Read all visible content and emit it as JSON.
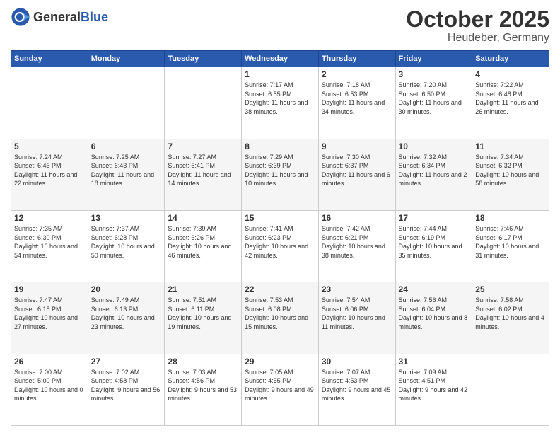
{
  "header": {
    "logo_general": "General",
    "logo_blue": "Blue",
    "month": "October 2025",
    "location": "Heudeber, Germany"
  },
  "weekdays": [
    "Sunday",
    "Monday",
    "Tuesday",
    "Wednesday",
    "Thursday",
    "Friday",
    "Saturday"
  ],
  "weeks": [
    [
      {
        "day": "",
        "info": ""
      },
      {
        "day": "",
        "info": ""
      },
      {
        "day": "",
        "info": ""
      },
      {
        "day": "1",
        "info": "Sunrise: 7:17 AM\nSunset: 6:55 PM\nDaylight: 11 hours\nand 38 minutes."
      },
      {
        "day": "2",
        "info": "Sunrise: 7:18 AM\nSunset: 6:53 PM\nDaylight: 11 hours\nand 34 minutes."
      },
      {
        "day": "3",
        "info": "Sunrise: 7:20 AM\nSunset: 6:50 PM\nDaylight: 11 hours\nand 30 minutes."
      },
      {
        "day": "4",
        "info": "Sunrise: 7:22 AM\nSunset: 6:48 PM\nDaylight: 11 hours\nand 26 minutes."
      }
    ],
    [
      {
        "day": "5",
        "info": "Sunrise: 7:24 AM\nSunset: 6:46 PM\nDaylight: 11 hours\nand 22 minutes."
      },
      {
        "day": "6",
        "info": "Sunrise: 7:25 AM\nSunset: 6:43 PM\nDaylight: 11 hours\nand 18 minutes."
      },
      {
        "day": "7",
        "info": "Sunrise: 7:27 AM\nSunset: 6:41 PM\nDaylight: 11 hours\nand 14 minutes."
      },
      {
        "day": "8",
        "info": "Sunrise: 7:29 AM\nSunset: 6:39 PM\nDaylight: 11 hours\nand 10 minutes."
      },
      {
        "day": "9",
        "info": "Sunrise: 7:30 AM\nSunset: 6:37 PM\nDaylight: 11 hours\nand 6 minutes."
      },
      {
        "day": "10",
        "info": "Sunrise: 7:32 AM\nSunset: 6:34 PM\nDaylight: 11 hours\nand 2 minutes."
      },
      {
        "day": "11",
        "info": "Sunrise: 7:34 AM\nSunset: 6:32 PM\nDaylight: 10 hours\nand 58 minutes."
      }
    ],
    [
      {
        "day": "12",
        "info": "Sunrise: 7:35 AM\nSunset: 6:30 PM\nDaylight: 10 hours\nand 54 minutes."
      },
      {
        "day": "13",
        "info": "Sunrise: 7:37 AM\nSunset: 6:28 PM\nDaylight: 10 hours\nand 50 minutes."
      },
      {
        "day": "14",
        "info": "Sunrise: 7:39 AM\nSunset: 6:26 PM\nDaylight: 10 hours\nand 46 minutes."
      },
      {
        "day": "15",
        "info": "Sunrise: 7:41 AM\nSunset: 6:23 PM\nDaylight: 10 hours\nand 42 minutes."
      },
      {
        "day": "16",
        "info": "Sunrise: 7:42 AM\nSunset: 6:21 PM\nDaylight: 10 hours\nand 38 minutes."
      },
      {
        "day": "17",
        "info": "Sunrise: 7:44 AM\nSunset: 6:19 PM\nDaylight: 10 hours\nand 35 minutes."
      },
      {
        "day": "18",
        "info": "Sunrise: 7:46 AM\nSunset: 6:17 PM\nDaylight: 10 hours\nand 31 minutes."
      }
    ],
    [
      {
        "day": "19",
        "info": "Sunrise: 7:47 AM\nSunset: 6:15 PM\nDaylight: 10 hours\nand 27 minutes."
      },
      {
        "day": "20",
        "info": "Sunrise: 7:49 AM\nSunset: 6:13 PM\nDaylight: 10 hours\nand 23 minutes."
      },
      {
        "day": "21",
        "info": "Sunrise: 7:51 AM\nSunset: 6:11 PM\nDaylight: 10 hours\nand 19 minutes."
      },
      {
        "day": "22",
        "info": "Sunrise: 7:53 AM\nSunset: 6:08 PM\nDaylight: 10 hours\nand 15 minutes."
      },
      {
        "day": "23",
        "info": "Sunrise: 7:54 AM\nSunset: 6:06 PM\nDaylight: 10 hours\nand 11 minutes."
      },
      {
        "day": "24",
        "info": "Sunrise: 7:56 AM\nSunset: 6:04 PM\nDaylight: 10 hours\nand 8 minutes."
      },
      {
        "day": "25",
        "info": "Sunrise: 7:58 AM\nSunset: 6:02 PM\nDaylight: 10 hours\nand 4 minutes."
      }
    ],
    [
      {
        "day": "26",
        "info": "Sunrise: 7:00 AM\nSunset: 5:00 PM\nDaylight: 10 hours\nand 0 minutes."
      },
      {
        "day": "27",
        "info": "Sunrise: 7:02 AM\nSunset: 4:58 PM\nDaylight: 9 hours\nand 56 minutes."
      },
      {
        "day": "28",
        "info": "Sunrise: 7:03 AM\nSunset: 4:56 PM\nDaylight: 9 hours\nand 53 minutes."
      },
      {
        "day": "29",
        "info": "Sunrise: 7:05 AM\nSunset: 4:55 PM\nDaylight: 9 hours\nand 49 minutes."
      },
      {
        "day": "30",
        "info": "Sunrise: 7:07 AM\nSunset: 4:53 PM\nDaylight: 9 hours\nand 45 minutes."
      },
      {
        "day": "31",
        "info": "Sunrise: 7:09 AM\nSunset: 4:51 PM\nDaylight: 9 hours\nand 42 minutes."
      },
      {
        "day": "",
        "info": ""
      }
    ]
  ]
}
